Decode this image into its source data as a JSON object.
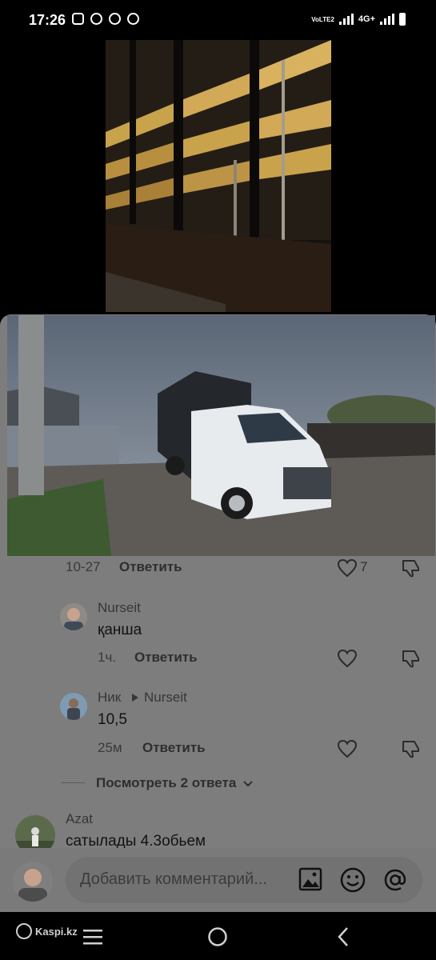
{
  "status_bar": {
    "time": "17:26",
    "network": "4G+",
    "volte": "VoLTE2"
  },
  "comments": [
    {
      "id": "c0",
      "timestamp": "10-27",
      "reply_label": "Ответить",
      "likes": "7"
    },
    {
      "id": "c1",
      "user": "Nurseit",
      "text": "қанша",
      "timestamp": "1ч.",
      "reply_label": "Ответить"
    },
    {
      "id": "c2",
      "user": "Ник",
      "reply_to": "Nurseit",
      "text": "10,5",
      "timestamp": "25м",
      "reply_label": "Ответить"
    },
    {
      "id": "c3",
      "user": "Azat",
      "text": "сатылады 4.3обьем"
    }
  ],
  "view_replies": "Посмотреть 2 ответа",
  "comment_input": {
    "placeholder": "Добавить комментарий..."
  },
  "watermark": "Kaspi.kz",
  "colors": {
    "overlay": "#7d7d7d",
    "status_bg": "#000000"
  }
}
